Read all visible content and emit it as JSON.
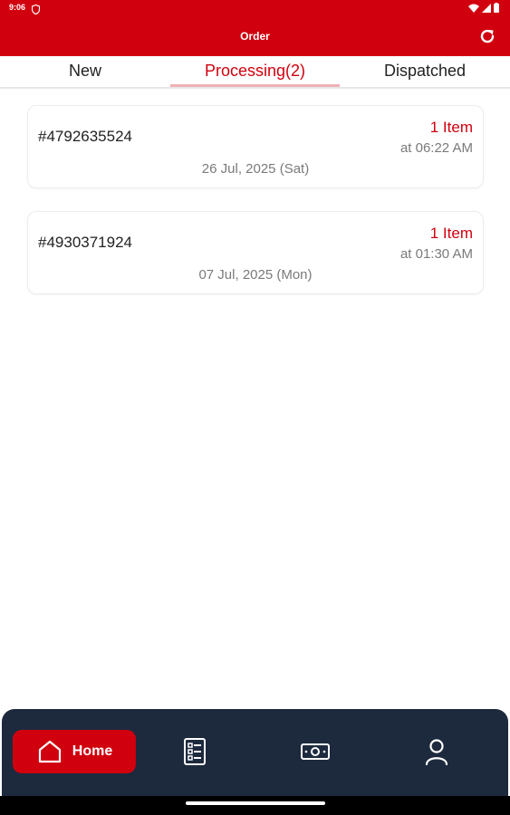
{
  "status_bar": {
    "time": "9:06"
  },
  "appbar": {
    "title": "Order"
  },
  "tabs": [
    {
      "label": "New"
    },
    {
      "label": "Processing(2)"
    },
    {
      "label": "Dispatched"
    }
  ],
  "orders": [
    {
      "id": "#4792635524",
      "items": "1 Item",
      "time": "at 06:22 AM",
      "date": "26 Jul, 2025 (Sat)"
    },
    {
      "id": "#4930371924",
      "items": "1 Item",
      "time": "at 01:30 AM",
      "date": "07 Jul, 2025 (Mon)"
    }
  ],
  "bottom_nav": {
    "home_label": "Home"
  },
  "icons": {
    "refresh": "refresh-icon",
    "home": "home-icon",
    "orders": "order-list-icon",
    "payments": "cash-icon",
    "profile": "user-icon"
  },
  "colors": {
    "brand": "#d0000e",
    "nav_bg": "#1d2a3e",
    "muted_text": "#7a7a7a"
  }
}
